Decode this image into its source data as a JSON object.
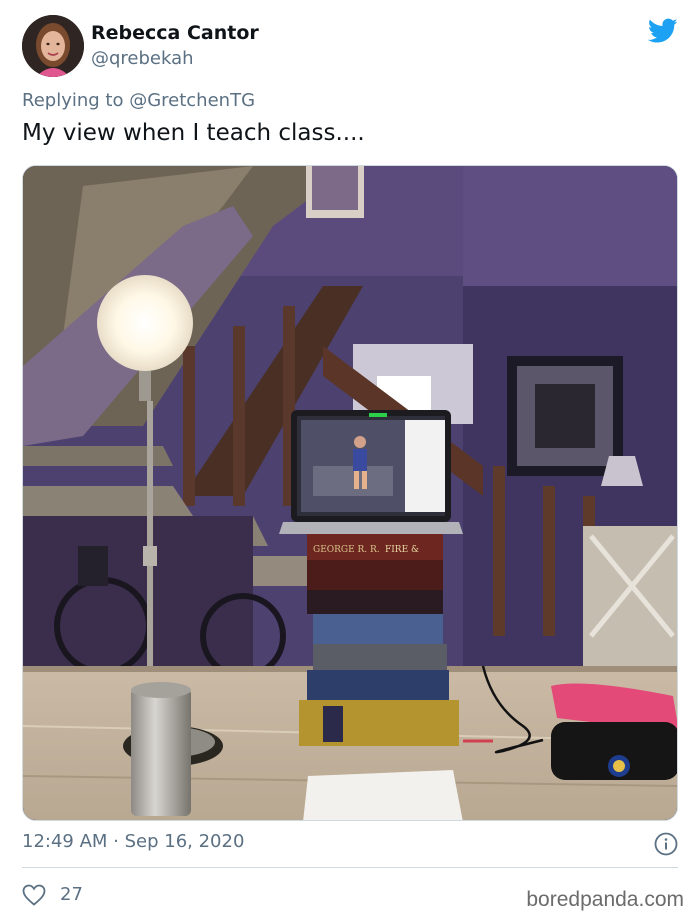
{
  "tweet": {
    "display_name": "Rebecca Cantor",
    "handle": "@qrebekah",
    "reply_prefix": "Replying to ",
    "reply_mention": "@GretchenTG",
    "text": "My view when I teach class....",
    "timestamp": "12:49 AM · Sep 16, 2020",
    "like_count": "27"
  },
  "photo": {
    "book_martin": "GEORGE R. R. MARTIN",
    "book_fire_blood": "FIRE & BLOOD"
  },
  "icons": {
    "brand": "twitter-bird-icon",
    "info": "info-icon",
    "like": "heart-icon"
  },
  "colors": {
    "brand_blue": "#1da1f2",
    "secondary_text": "#5b7083"
  },
  "watermark": "boredpanda.com"
}
